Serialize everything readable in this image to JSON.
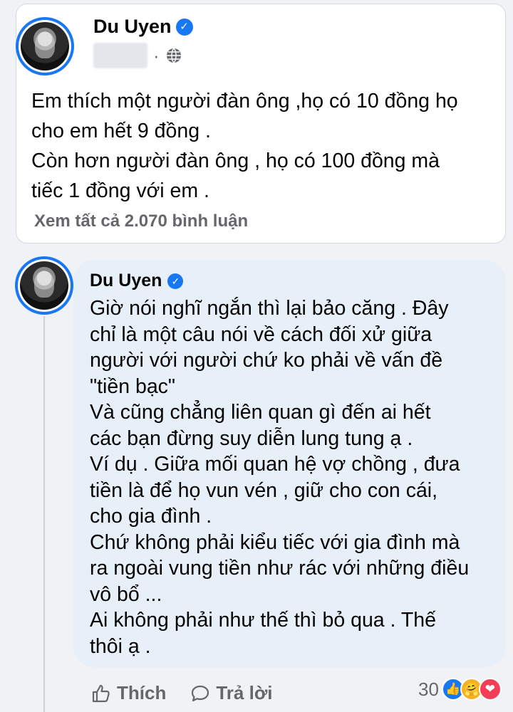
{
  "post": {
    "author": "Du Uyen",
    "body": "Em thích một người đàn ông ,họ có 10 đồng họ\ncho em hết 9 đồng .\nCòn hơn người đàn ông , họ có 100 đồng mà\ntiếc 1 đồng với em .",
    "view_comments": "Xem tất cả 2.070 bình luận"
  },
  "comment": {
    "author": "Du Uyen",
    "text": "Giờ nói nghĩ ngắn thì lại bảo căng . Đây\nchỉ là một câu nói về cách đối xử giữa\nngười với người chứ ko phải về vấn đề\n\"tiền bạc\"\nVà cũng chẳng liên quan gì đến ai  hết\ncác bạn đừng suy diễn lung tung ạ .\nVí dụ . Giữa mối quan hệ vợ chồng , đưa\ntiền là để họ vun vén , giữ cho con cái,\ncho gia  đình .\nChứ không phải kiểu tiếc với gia đình mà\nra ngoài vung tiền như rác với những điều\nvô bổ ...\nAi không phải như thế thì bỏ qua . Thế\nthôi ạ .",
    "like_label": "Thích",
    "reply_label": "Trả lời",
    "reaction_count": "30",
    "reactions": [
      "like-icon",
      "care-icon",
      "love-icon"
    ]
  },
  "colors": {
    "accent": "#1877f2",
    "bubble": "#e7eff9",
    "muted_text": "#65676b"
  }
}
